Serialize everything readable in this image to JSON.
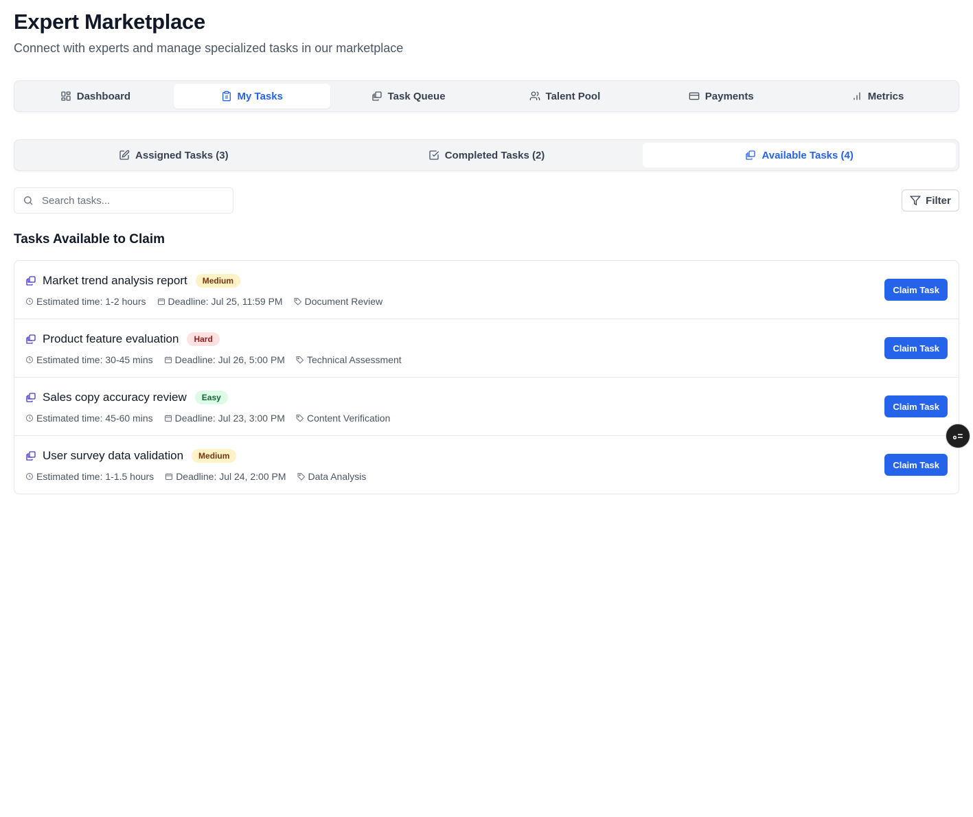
{
  "header": {
    "title": "Expert Marketplace",
    "subtitle": "Connect with experts and manage specialized tasks in our marketplace"
  },
  "main_tabs": [
    {
      "label": "Dashboard",
      "icon": "grid-icon",
      "active": false
    },
    {
      "label": "My Tasks",
      "icon": "clipboard-icon",
      "active": true
    },
    {
      "label": "Task Queue",
      "icon": "copy-icon",
      "active": false
    },
    {
      "label": "Talent Pool",
      "icon": "users-icon",
      "active": false
    },
    {
      "label": "Payments",
      "icon": "credit-card-icon",
      "active": false
    },
    {
      "label": "Metrics",
      "icon": "bar-chart-icon",
      "active": false
    }
  ],
  "sub_tabs": [
    {
      "label": "Assigned Tasks (3)",
      "icon": "edit-icon",
      "active": false
    },
    {
      "label": "Completed Tasks (2)",
      "icon": "check-square-icon",
      "active": false
    },
    {
      "label": "Available Tasks (4)",
      "icon": "copy-icon",
      "active": true
    }
  ],
  "search": {
    "placeholder": "Search tasks...",
    "value": ""
  },
  "filter": {
    "label": "Filter"
  },
  "section": {
    "title": "Tasks Available to Claim"
  },
  "tasks": [
    {
      "title": "Market trend analysis report",
      "difficulty": "Medium",
      "estimated": "Estimated time: 1-2 hours",
      "deadline": "Deadline: Jul 25, 11:59 PM",
      "category": "Document Review",
      "action": "Claim Task"
    },
    {
      "title": "Product feature evaluation",
      "difficulty": "Hard",
      "estimated": "Estimated time: 30-45 mins",
      "deadline": "Deadline: Jul 26, 5:00 PM",
      "category": "Technical Assessment",
      "action": "Claim Task"
    },
    {
      "title": "Sales copy accuracy review",
      "difficulty": "Easy",
      "estimated": "Estimated time: 45-60 mins",
      "deadline": "Deadline: Jul 23, 3:00 PM",
      "category": "Content Verification",
      "action": "Claim Task"
    },
    {
      "title": "User survey data validation",
      "difficulty": "Medium",
      "estimated": "Estimated time: 1-1.5 hours",
      "deadline": "Deadline: Jul 24, 2:00 PM",
      "category": "Data Analysis",
      "action": "Claim Task"
    }
  ],
  "colors": {
    "accent": "#2563eb",
    "task_icon": "#4338ca",
    "medium_badge": "#fef3c7",
    "hard_badge": "#fee2e2",
    "easy_badge": "#dcfce7"
  }
}
